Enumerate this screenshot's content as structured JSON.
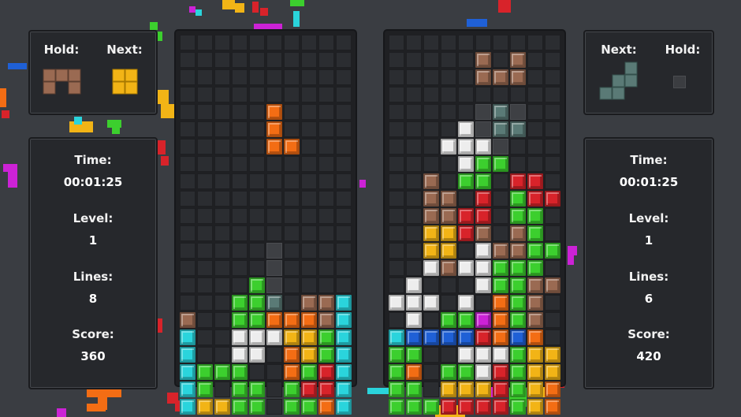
{
  "colors": {
    "background": "#3a3d42",
    "panel": "#26282c",
    "cyan": "#2ad4dc",
    "green": "#3ccf2e",
    "orange": "#f36d14",
    "yellow": "#f2b416",
    "gray": "#5a7a76",
    "brown": "#9a6a52",
    "red": "#d8232a",
    "blue": "#1f60d6",
    "white": "#ededed",
    "magenta": "#cc22d6",
    "shadow": "#3e4044"
  },
  "player1": {
    "hold_label": "Hold:",
    "next_label": "Next:",
    "hold_piece": "brown-z-piece",
    "next_piece": "yellow-o-piece",
    "stats": {
      "time_label": "Time:",
      "time": "00:01:25",
      "level_label": "Level:",
      "level": "1",
      "lines_label": "Lines:",
      "lines": "8",
      "score_label": "Score:",
      "score": "360"
    },
    "grid": [
      "..........",
      "..........",
      "..........",
      "..........",
      ".....O....",
      ".....O....",
      ".....OO...",
      "..........",
      "..........",
      "..........",
      "..........",
      "..........",
      "..........",
      ".....S....",
      "....GS....",
      "...GGS.BBC",
      "B..GGOOOBC",
      "C..WWWYYGC",
      "C..WW.OYGC",
      "CGGG..OGRC",
      "CG.GG.GRRC",
      "CYYGG.GGOC"
    ]
  },
  "player2": {
    "hold_label": "Hold:",
    "next_label": "Next:",
    "hold_piece": "empty-hold-slot",
    "next_piece": "gray-s-piece",
    "stats": {
      "time_label": "Time:",
      "time": "00:01:25",
      "level_label": "Level:",
      "level": "1",
      "lines_label": "Lines:",
      "lines": "6",
      "score_label": "Score:",
      "score": "420"
    },
    "grid": [
      "..........",
      ".....B.B..",
      ".....BBB..",
      "..........",
      ".....SSS..",
      "....W.SS..",
      "...WWWS...",
      "....WGG...",
      "..B.GG.RR.",
      "..BB.R.GRR",
      "..BBRR.GG.",
      "..YYRB.BG.",
      "..YY.WBBGG",
      "..WBWWGGG.",
      ".W...WGGBB",
      "WWW.W.OGB.",
      ".W.GGMOGB.",
      "CUUUUROUO.",
      "GG..WWWGYY",
      "GO.GGWRGYY",
      "GG.YYYRGYO",
      "GGGRRRRGYO"
    ]
  }
}
